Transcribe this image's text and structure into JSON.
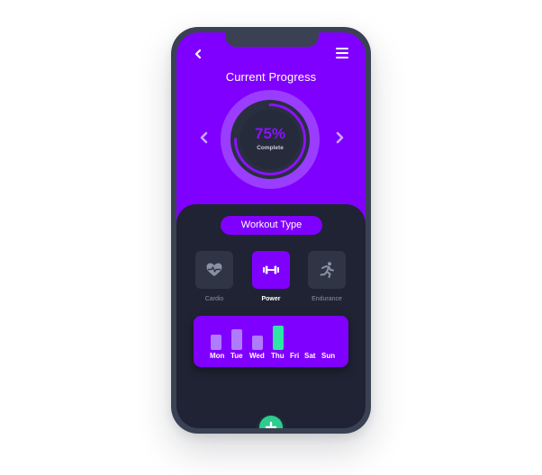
{
  "header": {
    "title": "Current Progress",
    "back_icon": "chevron-left-icon",
    "menu_icon": "hamburger-menu-icon"
  },
  "progress": {
    "value_label": "75%",
    "percent": 75,
    "caption": "Complete",
    "prev_icon": "chevron-left-icon",
    "next_icon": "chevron-right-icon"
  },
  "workout": {
    "section_label": "Workout Type",
    "types": [
      {
        "label": "Cardio",
        "icon": "heartbeat-icon",
        "active": false
      },
      {
        "label": "Power",
        "icon": "dumbbell-icon",
        "active": true
      },
      {
        "label": "Endurance",
        "icon": "running-icon",
        "active": false
      }
    ]
  },
  "week": {
    "days": [
      "Mon",
      "Tue",
      "Wed",
      "Thu",
      "Fri",
      "Sat",
      "Sun"
    ],
    "levels": [
      0.45,
      0.6,
      0.42,
      0.7,
      0,
      0,
      0
    ],
    "current_day": "Thu"
  },
  "actions": {
    "add_icon": "plus-icon"
  },
  "colors": {
    "accent": "#8000ff",
    "panel": "#1f2333",
    "today_bar": "#2ee6a6",
    "add_button": "#2ecc8f"
  }
}
